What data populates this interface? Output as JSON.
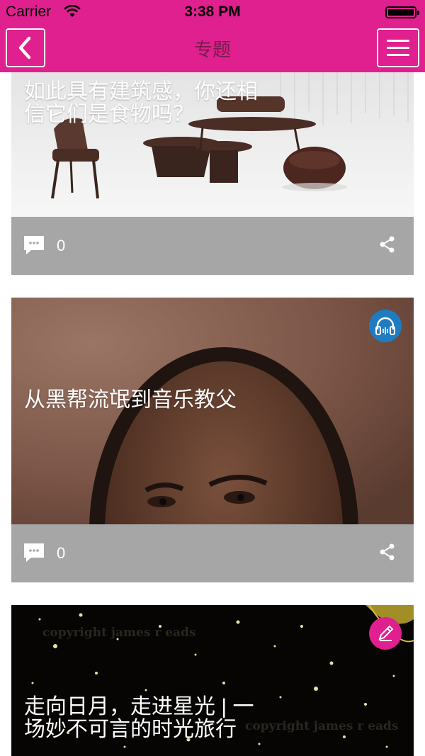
{
  "status_bar": {
    "carrier": "Carrier",
    "time": "3:38 PM"
  },
  "nav": {
    "title": "专题",
    "back_icon": "chevron-left-icon",
    "menu_icon": "hamburger-menu-icon"
  },
  "colors": {
    "brand": "#e0208e",
    "footer": "#a6a6a6",
    "audio_badge": "#1f7cc1"
  },
  "feed": {
    "cards": [
      {
        "title": "如此具有建筑感，你还相\n信它们是食物吗？",
        "comment_count": "0",
        "badge": ""
      },
      {
        "title": "从黑帮流氓到音乐教父",
        "comment_count": "0",
        "badge": "headphones-icon"
      },
      {
        "title": "走向日月，走进星光 | 一\n场妙不可言的时光旅行",
        "comment_count": "",
        "badge": "pencil-icon"
      }
    ]
  }
}
